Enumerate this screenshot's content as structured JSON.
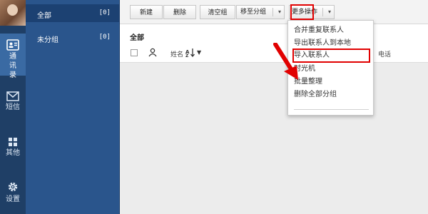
{
  "rail": {
    "items": [
      {
        "label": "通讯录",
        "icon": "contacts-card-icon",
        "active": true
      },
      {
        "label": "短信",
        "icon": "envelope-icon",
        "active": false
      },
      {
        "label": "其他",
        "icon": "grid-icon",
        "active": false
      },
      {
        "label": "设置",
        "icon": "gear-icon",
        "active": false
      }
    ]
  },
  "groups": [
    {
      "name": "全部",
      "count": "[0]",
      "selected": true
    },
    {
      "name": "未分组",
      "count": "[0]",
      "selected": false
    }
  ],
  "toolbar": {
    "new_label": "新建",
    "delete_label": "删除",
    "clear_label": "清空组",
    "move_label": "移至分组",
    "more_label": "更多操作"
  },
  "list": {
    "section_title": "全部",
    "name_header": "姓名",
    "phone_header": "电话"
  },
  "more_menu": {
    "items": [
      "合并重复联系人",
      "导出联系人到本地",
      "导入联系人",
      "时光机",
      "批量整理",
      "删除全部分组"
    ],
    "highlighted": "导入联系人"
  },
  "colors": {
    "rail": "#1f3f66",
    "groups_panel": "#2a558c",
    "annotation_red": "#e10000"
  }
}
